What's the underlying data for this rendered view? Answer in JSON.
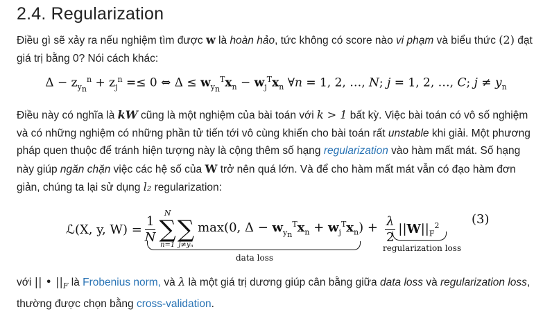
{
  "section_title": "2.4. Regularization",
  "p1": {
    "t1": "Điều gì sẽ xảy ra nếu nghiệm tìm được ",
    "w": "w",
    "t2": " là ",
    "perfect": "hoàn hảo",
    "t3": ", tức không có score nào ",
    "violate": "vi phạm",
    "t4": " và biểu thức ",
    "ref": "(2)",
    "t5": " đạt giá trị bằng 0? Nói cách khác:"
  },
  "eq1": "Δ − z<sub>y<sub>n</sub></sub><sup>n</sup> + z<sub>j</sub><sup>n</sup> =≤ 0 ⇔ Δ ≤ <b>w</b><sub>y<sub>n</sub></sub><sup>T</sup><b>x</b><sub>n</sub> − <b>w</b><sub>j</sub><sup>T</sup><b>x</b><sub>n</sub> ∀<i>n</i> = 1, 2, …, <i>N</i>; <i>j</i> = 1, 2, …, <i>C</i>; <i>j</i> ≠ <i>y</i><sub>n</sub>",
  "p2": {
    "t1": "Điều này có nghĩa là ",
    "kW": "kW",
    "t2": " cũng là một nghiệm của bài toán với ",
    "k_gt_1": "k > 1",
    "t3": " bất kỳ. Việc bài toán có vô số nghiệm và có những nghiệm có những phần tử tiến tới vô cùng khiến cho bài toán rất ",
    "unstable": "unstable",
    "t4": " khi giải. Một phương pháp quen thuộc để tránh hiện tượng này là cộng thêm số hạng ",
    "regularization_link": "regularization",
    "t5": " vào hàm mất mát. Số hạng này giúp ",
    "prevent": "ngăn chặn",
    "t6": " việc các hệ số của ",
    "W": "W",
    "t7": " trở nên quá lớn. Và để cho hàm mất mát vẫn có đạo hàm đơn giản, chúng ta lại sử dụng ",
    "l2": "l₂",
    "t8": " regularization:"
  },
  "eq2": {
    "lhs": "ℒ(X, y, W) =",
    "frac1_num": "1",
    "frac1_den": "N",
    "sum1_top": "N",
    "sum1_bot": "n=1",
    "sum2_bot": "j≠yₙ",
    "body": "max(0, Δ − <b>w</b><sub>y<sub>n</sub></sub><sup>T</sup><b>x</b><sub>n</sub> + <b>w</b><sub>j</sub><sup>T</sup><b>x</b><sub>n</sub>) +",
    "frac2_num": "λ",
    "frac2_den": "2",
    "norm": "||<b>W</b>||<sub>F</sub><sup>2</sup>",
    "number": "(3)",
    "data_loss_label": "data loss",
    "reg_loss_label": "regularization loss"
  },
  "p3": {
    "t1": "với ",
    "norm_symbol": "|| • ||",
    "norm_sub": "F",
    "t2": " là ",
    "frobenius_link": "Frobenius norm,",
    "t3": " và ",
    "lambda": "λ",
    "t4": " là một giá trị dương giúp cân bằng giữa ",
    "data_loss": "data loss",
    "t5": " và ",
    "reg_loss": "regularization loss",
    "t6": ", thường được chọn bằng ",
    "cv_link": "cross-validation",
    "t7": "."
  }
}
